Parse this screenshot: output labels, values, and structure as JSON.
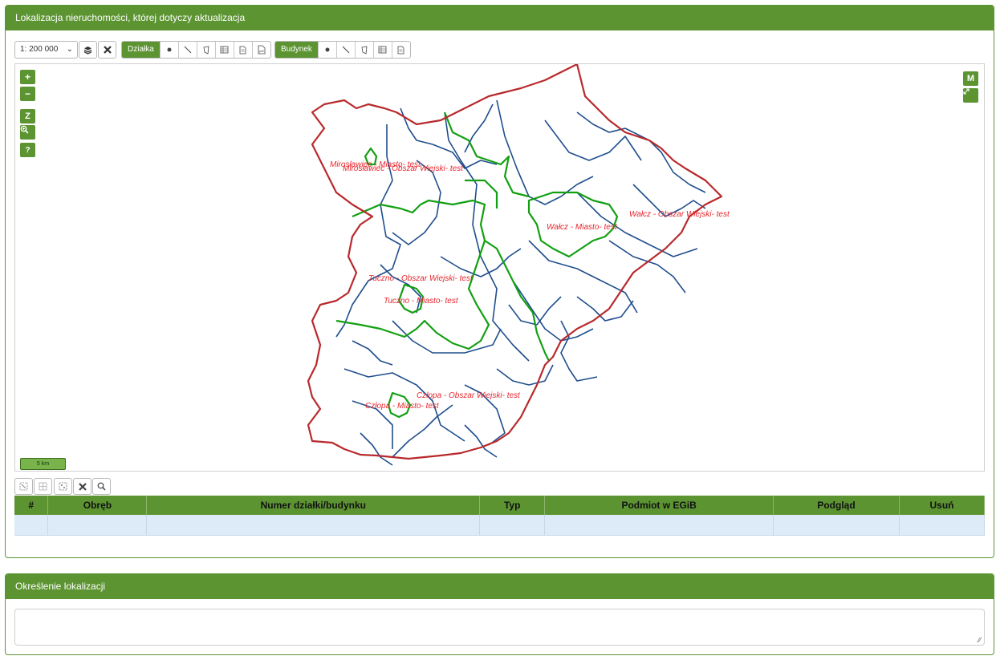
{
  "panel1": {
    "title": "Lokalizacja nieruchomości, której dotyczy aktualizacja"
  },
  "panel2": {
    "title": "Określenie lokalizacji",
    "textarea_value": ""
  },
  "toolbar": {
    "scale_value": "1: 200 000",
    "layers_icon": "layers-icon",
    "clear_icon": "close-icon",
    "dzialka_label": "Działka",
    "budynek_label": "Budynek"
  },
  "map": {
    "zoom_in": "+",
    "zoom_out": "−",
    "z_label": "Z",
    "zoom_area_icon": "zoom-area-icon",
    "help_label": "?",
    "m_label": "M",
    "fullscreen_icon": "expand-icon",
    "scale_label": "5 km",
    "labels": [
      "Mirosławiec - Miasto- test",
      "Mirosławiec - Obszar Wiejski- test",
      "Wałcz - Obszar Wiejski- test",
      "Wałcz - Miasto- test",
      "Tuczno - Obszar Wiejski- test",
      "Tuczno - Miasto- test",
      "Człopa - Obszar Wiejski- test",
      "Człopa - Miasto- test"
    ],
    "colors": {
      "outer": "#b8292c",
      "district": "#1f4e8c",
      "commune": "#12a012"
    }
  },
  "table": {
    "headers": [
      "#",
      "Obręb",
      "Numer działki/budynku",
      "Typ",
      "Podmiot w EGiB",
      "Podgląd",
      "Usuń"
    ],
    "rows": [
      [
        "",
        "",
        "",
        "",
        "",
        "",
        ""
      ]
    ]
  },
  "colors": {
    "accent": "#5c9432",
    "row_bg": "#dcebf7"
  }
}
